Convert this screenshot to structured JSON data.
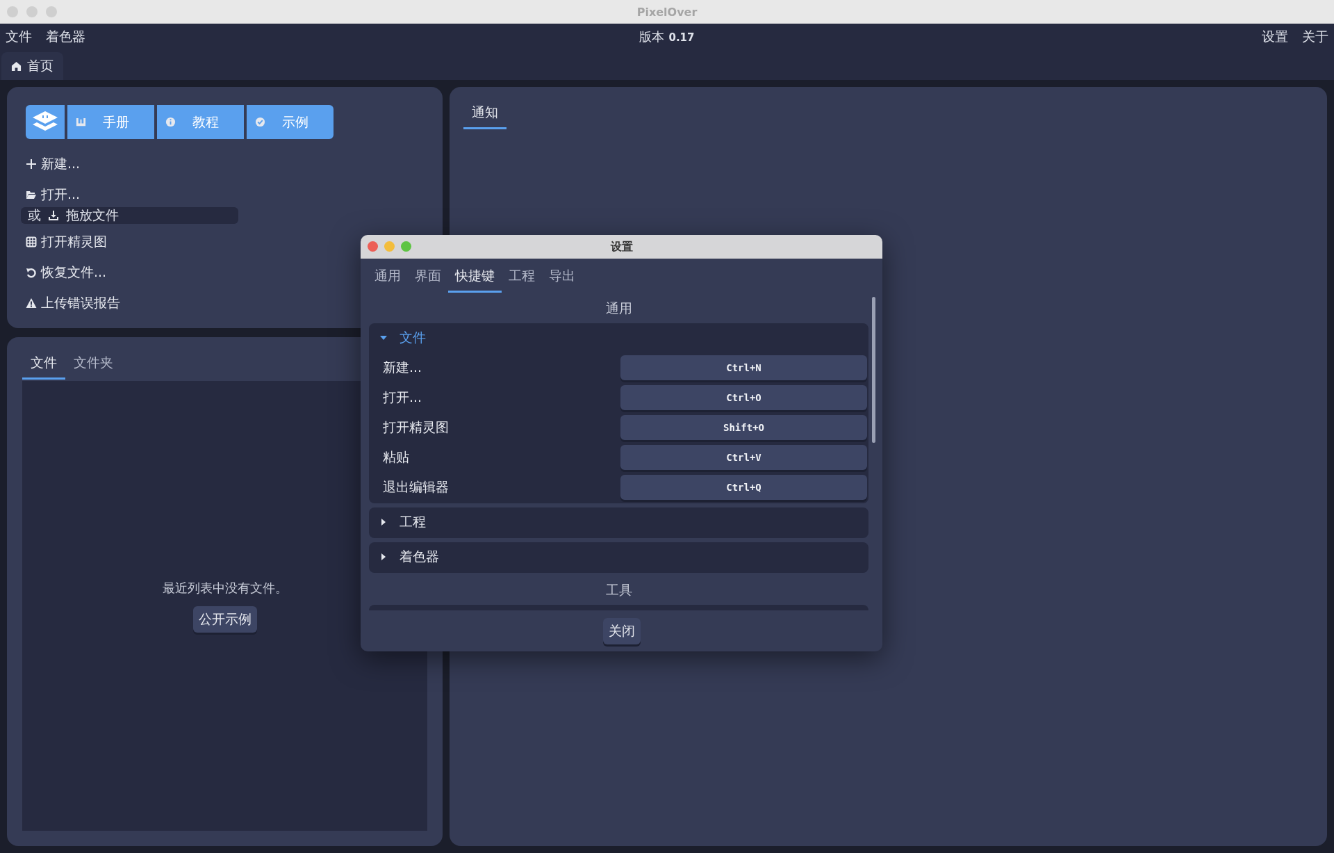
{
  "window": {
    "title": "PixelOver"
  },
  "menu_bar": {
    "left": [
      "文件",
      "着色器"
    ],
    "version_label": "版本",
    "version": "0.17",
    "right": [
      "设置",
      "关于"
    ]
  },
  "tabs": [
    {
      "label": "首页",
      "selected": true
    }
  ],
  "start_panel": {
    "buttons": [
      "手册",
      "教程",
      "示例"
    ],
    "actions": [
      {
        "label": "新建..."
      },
      {
        "label": "打开...",
        "hint": {
          "prefix": "或",
          "label": "拖放文件"
        }
      },
      {
        "label": "打开精灵图"
      },
      {
        "label": "恢复文件..."
      },
      {
        "label": "上传错误报告"
      }
    ]
  },
  "files_panel": {
    "tabs": [
      {
        "label": "文件",
        "selected": true
      },
      {
        "label": "文件夹",
        "selected": false
      }
    ],
    "empty_message": "最近列表中没有文件。",
    "button": "公开示例"
  },
  "notifications_panel": {
    "tabs": [
      {
        "label": "通知",
        "selected": true
      }
    ]
  },
  "settings_dialog": {
    "title": "设置",
    "tabs": [
      {
        "label": "通用",
        "selected": false
      },
      {
        "label": "界面",
        "selected": false
      },
      {
        "label": "快捷键",
        "selected": true
      },
      {
        "label": "工程",
        "selected": false
      },
      {
        "label": "导出",
        "selected": false
      }
    ],
    "sections": [
      {
        "title": "通用",
        "groups": [
          {
            "name": "文件",
            "expanded": true,
            "shortcuts": [
              {
                "action": "新建...",
                "key": "Ctrl+N"
              },
              {
                "action": "打开...",
                "key": "Ctrl+O"
              },
              {
                "action": "打开精灵图",
                "key": "Shift+O"
              },
              {
                "action": "粘贴",
                "key": "Ctrl+V"
              },
              {
                "action": "退出编辑器",
                "key": "Ctrl+Q"
              }
            ]
          },
          {
            "name": "工程",
            "expanded": false
          },
          {
            "name": "着色器",
            "expanded": false
          }
        ]
      },
      {
        "title": "工具"
      }
    ],
    "close_button": "关闭"
  }
}
